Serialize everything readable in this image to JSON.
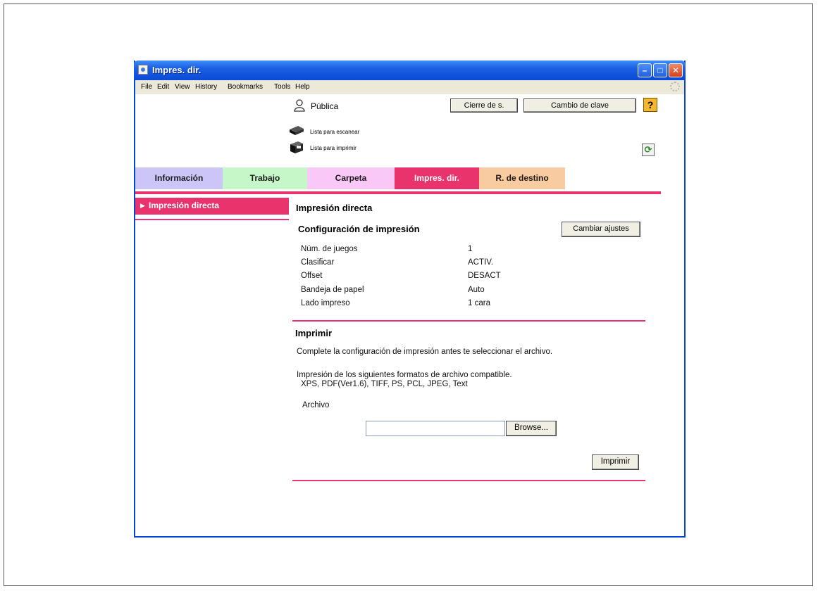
{
  "window": {
    "title": "Impres. dir.",
    "controls": {
      "minimize": "–",
      "maximize": "□",
      "close": "✕"
    }
  },
  "menu": [
    "File",
    "Edit",
    "View",
    "History",
    "Bookmarks",
    "Tools",
    "Help"
  ],
  "header": {
    "user_label": "Pública",
    "logout_label": "Cierre de s.",
    "change_password_label": "Cambio de clave",
    "help_label": "?",
    "scan_status": "Lista para escanear",
    "print_status": "Lista para imprimir",
    "refresh_label": "⟳"
  },
  "tabs": [
    {
      "label": "Información",
      "color": "#cbc6f7"
    },
    {
      "label": "Trabajo",
      "color": "#c6f7c9"
    },
    {
      "label": "Carpeta",
      "color": "#fac8f7"
    },
    {
      "label": "Impres. dir.",
      "color": "#e8336c",
      "active": true
    },
    {
      "label": "R. de destino",
      "color": "#f9cba1"
    }
  ],
  "sidebar": {
    "items": [
      {
        "label": "Impresión directa",
        "arrow": "▶",
        "active": true
      }
    ]
  },
  "main": {
    "heading": "Impresión directa",
    "config_heading": "Configuración de impresión",
    "change_settings_label": "Cambiar ajustes",
    "settings": [
      {
        "key": "Núm. de juegos",
        "value": "1"
      },
      {
        "key": "Clasificar",
        "value": "ACTIV."
      },
      {
        "key": "Offset",
        "value": "DESACT"
      },
      {
        "key": "Bandeja de papel",
        "value": "Auto"
      },
      {
        "key": "Lado impreso",
        "value": "1 cara"
      }
    ],
    "print_heading": "Imprimir",
    "print_instructions": "Complete la configuración de impresión antes te seleccionar el archivo.",
    "formats_intro": "Impresión de los siguientes formatos de archivo compatible.",
    "formats_list": "XPS, PDF(Ver1.6), TIFF, PS, PCL, JPEG, Text",
    "file_label": "Archivo",
    "file_value": "",
    "browse_label": "Browse...",
    "print_label": "Imprimir"
  },
  "colors": {
    "accent": "#e8336c",
    "titlebar": "#0a4ad6"
  }
}
